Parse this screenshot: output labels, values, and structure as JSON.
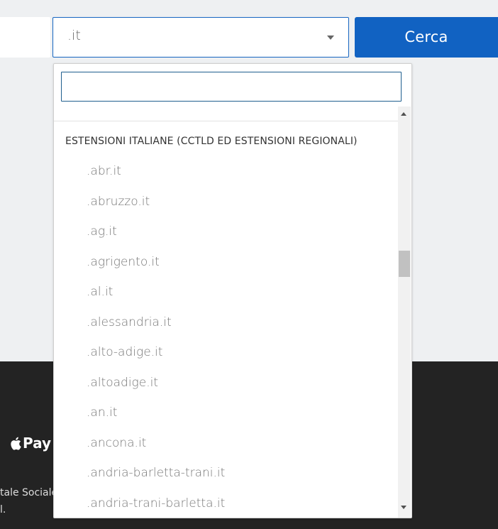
{
  "search_bar": {
    "domain_input_value": "",
    "extension_select": {
      "selected": ".it"
    },
    "search_button_label": "Cerca"
  },
  "dropdown": {
    "search_value": "",
    "group_header": "ESTENSIONI ITALIANE (CCTLD ED ESTENSIONI REGIONALI)",
    "options": [
      ".abr.it",
      ".abruzzo.it",
      ".ag.it",
      ".agrigento.it",
      ".al.it",
      ".alessandria.it",
      ".alto-adige.it",
      ".altoadige.it",
      ".an.it",
      ".ancona.it",
      ".andria-barletta-trani.it",
      ".andria-trani-barletta.it"
    ],
    "scroll_position_fraction": 0.36
  },
  "footer": {
    "apple_pay_label": "Pay",
    "text_line_1": "tale Sociale",
    "text_line_2": "l."
  },
  "colors": {
    "primary_button": "#1162c2",
    "select_border": "#1565c0",
    "footer_background": "#232323",
    "page_background": "#eef0f2"
  }
}
